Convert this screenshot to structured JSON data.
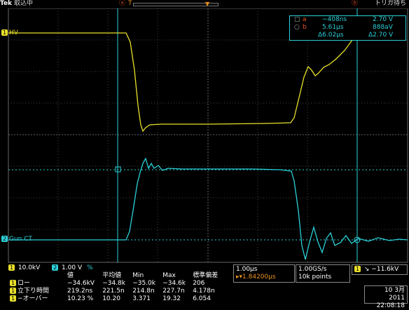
{
  "header": {
    "brand": "Tek",
    "state": "取込中",
    "trigger_state": "トリガ待ち"
  },
  "colors": {
    "ch1": "#e8e02a",
    "ch2": "#2bd0d8",
    "cursor": "#2bd0d8",
    "accent": "#e85020"
  },
  "channels": [
    {
      "badge": "1",
      "label": "HV",
      "scale": "10.0kV"
    },
    {
      "badge": "2",
      "label": "Gun CT",
      "scale": "1.00 V"
    }
  ],
  "cursor_readout": {
    "a_label": "a",
    "b_label": "b",
    "a_time": "−408ns",
    "a_value": "2.70 V",
    "b_time": "5.61μs",
    "b_value": "888aV",
    "delta_time": "Δ6.02μs",
    "delta_value": "Δ2.70 V"
  },
  "measurements": {
    "headers": [
      "値",
      "平均値",
      "Min",
      "Max",
      "標準偏差"
    ],
    "rows": [
      {
        "badge": "1",
        "name": "ロー",
        "values": [
          "−34.6kV",
          "−34.8k",
          "−35.0k",
          "−34.6k",
          "206"
        ]
      },
      {
        "badge": "1",
        "name": "立下り時間",
        "values": [
          "219.2ns",
          "221.5n",
          "214.8n",
          "227.7n",
          "4.178n"
        ]
      },
      {
        "badge": "1",
        "name": "−オーバー",
        "values": [
          "10.23 %",
          "10.20",
          "3.371",
          "19.32",
          "6.054"
        ]
      }
    ]
  },
  "scale_row": {
    "ch1": "10.0kV",
    "ch2": "1.00 V",
    "ch2_suffix": "%"
  },
  "horizontal": {
    "timebase": "1.00μs",
    "position": "1.84200μs",
    "sample_rate": "1.00GS/s",
    "record": "10k points"
  },
  "trigger": {
    "source": "1",
    "level": "−11.6kV"
  },
  "datetime": {
    "date": "10 3月  2011",
    "time": "22:08:18"
  },
  "waveforms": {
    "ch1_kv": {
      "high": -34.6,
      "low": -35.0
    },
    "ch2_v": {
      "peak": 2.7
    }
  }
}
